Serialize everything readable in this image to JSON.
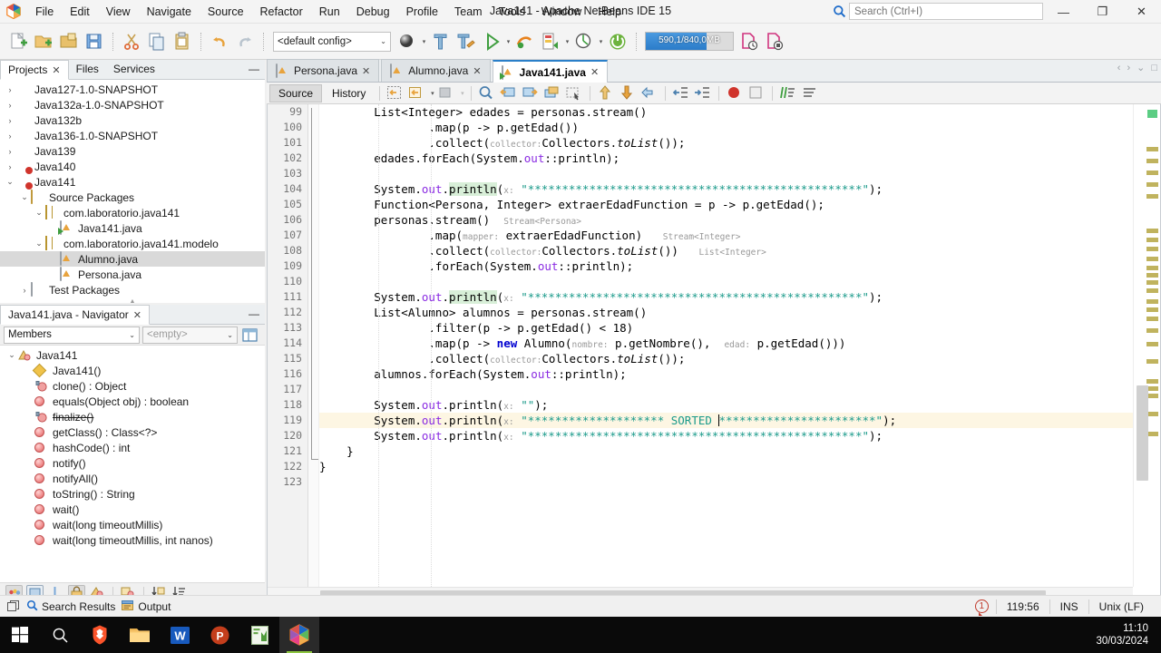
{
  "window": {
    "title": "Java141 - Apache NetBeans IDE 15",
    "minimize": "—",
    "restore": "❐",
    "close": "✕"
  },
  "menu": {
    "items": [
      "File",
      "Edit",
      "View",
      "Navigate",
      "Source",
      "Refactor",
      "Run",
      "Debug",
      "Profile",
      "Team",
      "Tools",
      "Window",
      "Help"
    ]
  },
  "search": {
    "placeholder": "Search (Ctrl+I)",
    "value": ""
  },
  "toolbar": {
    "config_label": "<default config>",
    "chevron": "⌄",
    "memory": "590,1/840,0MB",
    "icons": [
      "new-file-icon",
      "new-project-icon",
      "open-project-icon",
      "save-all-icon",
      "cut-icon",
      "copy-icon",
      "paste-icon",
      "undo-icon",
      "redo-icon",
      "set-main-project-icon",
      "build-project-icon",
      "clean-build-icon",
      "run-project-icon",
      "debug-project-icon",
      "profile-project-icon",
      "team-icon",
      "spring-boot-icon",
      "history-icon",
      "stop-icon"
    ]
  },
  "projects_panel": {
    "tabs": [
      {
        "label": "Projects",
        "closable": true,
        "active": true
      },
      {
        "label": "Files",
        "closable": false,
        "active": false
      },
      {
        "label": "Services",
        "closable": false,
        "active": false
      }
    ],
    "minimize": "—",
    "tree": [
      {
        "label": "Java127-1.0-SNAPSHOT",
        "depth": 0,
        "twist": "›",
        "icon": "project-icon",
        "selected": false
      },
      {
        "label": "Java132a-1.0-SNAPSHOT",
        "depth": 0,
        "twist": "›",
        "icon": "project-icon",
        "selected": false
      },
      {
        "label": "Java132b",
        "depth": 0,
        "twist": "›",
        "icon": "project-java-icon",
        "selected": false
      },
      {
        "label": "Java136-1.0-SNAPSHOT",
        "depth": 0,
        "twist": "›",
        "icon": "project-icon",
        "selected": false
      },
      {
        "label": "Java139",
        "depth": 0,
        "twist": "›",
        "icon": "project-java-icon",
        "selected": false
      },
      {
        "label": "Java140",
        "depth": 0,
        "twist": "›",
        "icon": "project-java-badge-icon",
        "selected": false
      },
      {
        "label": "Java141",
        "depth": 0,
        "twist": "⌄",
        "icon": "project-java-badge-icon",
        "selected": false
      },
      {
        "label": "Source Packages",
        "depth": 1,
        "twist": "⌄",
        "icon": "source-folder-icon",
        "selected": false
      },
      {
        "label": "com.laboratorio.java141",
        "depth": 2,
        "twist": "⌄",
        "icon": "package-icon",
        "selected": false
      },
      {
        "label": "Java141.java",
        "depth": 3,
        "twist": "",
        "icon": "java-main-file-icon",
        "selected": false
      },
      {
        "label": "com.laboratorio.java141.modelo",
        "depth": 2,
        "twist": "⌄",
        "icon": "package-icon",
        "selected": false
      },
      {
        "label": "Alumno.java",
        "depth": 3,
        "twist": "",
        "icon": "java-file-icon",
        "selected": true
      },
      {
        "label": "Persona.java",
        "depth": 3,
        "twist": "",
        "icon": "java-file-icon",
        "selected": false
      },
      {
        "label": "Test Packages",
        "depth": 1,
        "twist": "›",
        "icon": "test-folder-icon",
        "selected": false
      }
    ]
  },
  "navigator_panel": {
    "tab_label": "Java141.java - Navigator",
    "minimize": "—",
    "scope_select": "Members",
    "filter_select": "<empty>",
    "chevron": "⌄",
    "members": [
      {
        "label": "Java141",
        "depth": 0,
        "twist": "⌄",
        "icon": "class-icon",
        "strike": false
      },
      {
        "label": "Java141()",
        "depth": 1,
        "twist": "",
        "icon": "constructor-icon",
        "strike": false
      },
      {
        "label": "clone() : Object",
        "depth": 1,
        "twist": "",
        "icon": "method-protected-icon",
        "strike": false
      },
      {
        "label": "equals(Object obj) : boolean",
        "depth": 1,
        "twist": "",
        "icon": "method-icon",
        "strike": false
      },
      {
        "label": "finalize()",
        "depth": 1,
        "twist": "",
        "icon": "method-protected-icon",
        "strike": true
      },
      {
        "label": "getClass() : Class<?>",
        "depth": 1,
        "twist": "",
        "icon": "method-icon",
        "strike": false
      },
      {
        "label": "hashCode() : int",
        "depth": 1,
        "twist": "",
        "icon": "method-icon",
        "strike": false
      },
      {
        "label": "notify()",
        "depth": 1,
        "twist": "",
        "icon": "method-icon",
        "strike": false
      },
      {
        "label": "notifyAll()",
        "depth": 1,
        "twist": "",
        "icon": "method-icon",
        "strike": false
      },
      {
        "label": "toString() : String",
        "depth": 1,
        "twist": "",
        "icon": "method-icon",
        "strike": false
      },
      {
        "label": "wait()",
        "depth": 1,
        "twist": "",
        "icon": "method-icon",
        "strike": false
      },
      {
        "label": "wait(long timeoutMillis)",
        "depth": 1,
        "twist": "",
        "icon": "method-icon",
        "strike": false
      },
      {
        "label": "wait(long timeoutMillis, int nanos)",
        "depth": 1,
        "twist": "",
        "icon": "method-icon",
        "strike": false
      }
    ],
    "footer_icons": [
      "show-inherited-icon",
      "show-fields-icon",
      "show-bean-pattern-icon",
      "show-non-public-icon",
      "show-static-icon",
      "sort-alphabetically-icon",
      "sort-by-source-icon",
      "expand-all-icon"
    ]
  },
  "editor": {
    "tabs": [
      {
        "label": "Persona.java",
        "active": false,
        "icon": "java-file-icon"
      },
      {
        "label": "Alumno.java",
        "active": false,
        "icon": "java-file-icon"
      },
      {
        "label": "Java141.java",
        "active": true,
        "icon": "java-main-file-icon"
      }
    ],
    "close_glyph": "✕",
    "tab_nav": {
      "prev": "‹",
      "next": "›",
      "list": "⌄",
      "maximize": "□"
    },
    "view_buttons": [
      {
        "label": "Source",
        "active": true
      },
      {
        "label": "History",
        "active": false
      }
    ],
    "toolbar_icons": [
      "last-edit-icon",
      "back-icon",
      "forward-icon",
      "find-selection-icon",
      "previous-bookmark-icon",
      "next-bookmark-icon",
      "toggle-bookmark-icon",
      "select-rectangular-icon",
      "previous-error-icon",
      "next-error-icon",
      "toggle-highlight-icon",
      "shift-left-icon",
      "shift-right-icon",
      "start-macro-icon",
      "stop-macro-icon",
      "comment-icon",
      "uncomment-icon"
    ],
    "first_line": 99,
    "lines": [
      {
        "n": 99,
        "html": "        List&lt;Integer&gt; edades = personas.stream()"
      },
      {
        "n": 100,
        "html": "                .map(p -&gt; p.getEdad())"
      },
      {
        "n": 101,
        "html": "                .collect(<span class=\"hint\">collector:</span>Collectors.<i>toList</i>());"
      },
      {
        "n": 102,
        "html": "        edades.forEach(System.<span class=\"fld\">out</span>::println);"
      },
      {
        "n": 103,
        "html": ""
      },
      {
        "n": 104,
        "html": "        System.<span class=\"fld\">out</span>.<span class=\"mark\">println</span>(<span class=\"hint\">x:</span> <span class=\"str\">\"*************************************************\"</span>);"
      },
      {
        "n": 105,
        "html": "        Function&lt;Persona, Integer&gt; extraerEdadFunction = p -&gt; p.getEdad();"
      },
      {
        "n": 106,
        "html": "        personas.stream()  <span class=\"hint\">Stream&lt;Persona&gt;</span>"
      },
      {
        "n": 107,
        "html": "                .map(<span class=\"hint\">mapper:</span> extraerEdadFunction)   <span class=\"hint\">Stream&lt;Integer&gt;</span>"
      },
      {
        "n": 108,
        "html": "                .collect(<span class=\"hint\">collector:</span>Collectors.<i>toList</i>())   <span class=\"hint\">List&lt;Integer&gt;</span>"
      },
      {
        "n": 109,
        "html": "                .forEach(System.<span class=\"fld\">out</span>::println);"
      },
      {
        "n": 110,
        "html": ""
      },
      {
        "n": 111,
        "html": "        System.<span class=\"fld\">out</span>.<span class=\"mark\">println</span>(<span class=\"hint\">x:</span> <span class=\"str\">\"*************************************************\"</span>);"
      },
      {
        "n": 112,
        "html": "        List&lt;Alumno&gt; alumnos = personas.stream()"
      },
      {
        "n": 113,
        "html": "                .filter(p -&gt; p.getEdad() &lt; 18)"
      },
      {
        "n": 114,
        "html": "                .map(p -&gt; <span class=\"kw\">new</span> Alumno(<span class=\"hint\">nombre:</span> p.getNombre(),  <span class=\"hint\">edad:</span> p.getEdad()))"
      },
      {
        "n": 115,
        "html": "                .collect(<span class=\"hint\">collector:</span>Collectors.<i>toList</i>());"
      },
      {
        "n": 116,
        "html": "        alumnos.forEach(System.<span class=\"fld\">out</span>::println);"
      },
      {
        "n": 117,
        "html": ""
      },
      {
        "n": 118,
        "html": "        System.<span class=\"fld\">out</span>.println(<span class=\"hint\">x:</span> <span class=\"str\">\"\"</span>);"
      },
      {
        "n": 119,
        "html": "        System.<span class=\"fld\">out</span>.println(<span class=\"hint\">x:</span> <span class=\"str\">\"******************** SORTED </span><span class=\"caret\"></span><span class=\"str\">***********************\"</span>);",
        "highlight": true
      },
      {
        "n": 120,
        "html": "        System.<span class=\"fld\">out</span>.println(<span class=\"hint\">x:</span> <span class=\"str\">\"*************************************************\"</span>);"
      },
      {
        "n": 121,
        "html": "    }"
      },
      {
        "n": 122,
        "html": "}"
      },
      {
        "n": 123,
        "html": ""
      }
    ]
  },
  "status_tabs": [
    {
      "label": "Search Results",
      "icon": "search-icon"
    },
    {
      "label": "Output",
      "icon": "output-icon"
    }
  ],
  "status_right": {
    "notifications": "1",
    "position": "119:56",
    "insert_mode": "INS",
    "line_ending": "Unix (LF)"
  },
  "taskbar": {
    "items": [
      "start-icon",
      "search-icon",
      "brave-icon",
      "file-explorer-icon",
      "word-icon",
      "powerpoint-icon",
      "excel-icon",
      "netbeans-icon"
    ],
    "clock_time": "11:10",
    "clock_date": "30/03/2024"
  },
  "colors": {
    "accent": "#2a7fc9",
    "string": "#1a9a8a",
    "field": "#8a2be2",
    "keyword": "#0000d0",
    "highlight_line": "#fdf6e3"
  }
}
